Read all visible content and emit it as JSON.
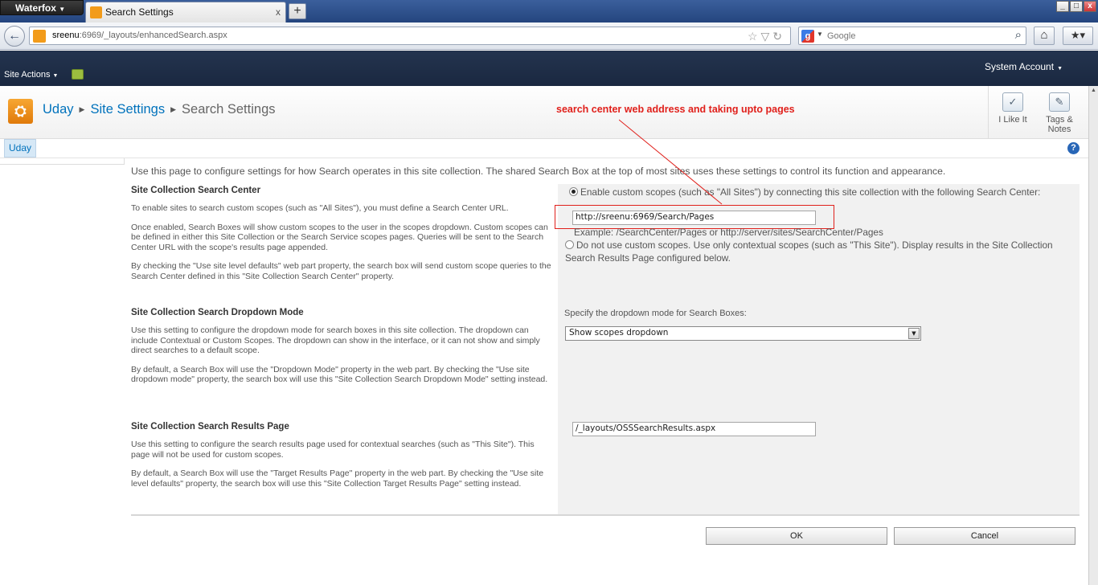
{
  "browser": {
    "app_button": "Waterfox",
    "tab_title": "Search Settings",
    "tab_close": "x",
    "new_tab": "+",
    "url_host": "sreenu",
    "url_rest": ":6969/_layouts/enhancedSearch.aspx",
    "search_placeholder": "Google",
    "window_controls": [
      "_",
      "□",
      "x"
    ]
  },
  "sharepoint": {
    "site_actions": "Site Actions",
    "system_account": "System Account",
    "breadcrumb": [
      "Uday",
      "Site Settings",
      "Search Settings"
    ],
    "annotation": "search center web address and taking upto pages",
    "i_like_it": "I Like It",
    "tags_notes_1": "Tags &",
    "tags_notes_2": "Notes",
    "top_nav_tab": "Uday",
    "help": "?"
  },
  "page": {
    "intro": "Use this page to configure settings for how Search operates in this site collection.  The shared Search Box at the top of most sites uses these settings to control its function and appearance.",
    "section1": {
      "title": "Site Collection Search Center",
      "desc": [
        "To enable sites to search custom scopes (such as \"All Sites\"), you must define a Search Center URL.",
        "Once enabled, Search Boxes will show custom scopes to the user in the scopes dropdown.  Custom scopes can be defined in either this Site Collection or the Search Service scopes pages.  Queries will be sent to the Search Center URL with the scope's results page appended.",
        "By checking the \"Use site level defaults\" web part property, the search box will send custom scope queries to the Search Center defined in this \"Site Collection Search Center\" property."
      ],
      "radio1": "Enable custom scopes (such as \"All Sites\") by connecting this site collection with the following Search Center:",
      "url_value": "http://sreenu:6969/Search/Pages",
      "example": "Example: /SearchCenter/Pages or http://server/sites/SearchCenter/Pages",
      "radio2": "Do not use custom scopes. Use only contextual scopes (such as \"This Site\"). Display results in the Site Collection Search Results Page configured below."
    },
    "section2": {
      "title": "Site Collection Search Dropdown Mode",
      "desc": [
        "Use this setting to configure the dropdown mode for search boxes in this site collection.  The dropdown can include Contextual or Custom Scopes.  The dropdown can show in the interface, or it can not show and simply direct searches to a default scope.",
        "By default, a Search Box will use the \"Dropdown Mode\" property in the web part.  By checking the \"Use site dropdown mode\" property, the search box will use this \"Site Collection Search Dropdown Mode\" setting instead."
      ],
      "label": "Specify the dropdown mode for Search Boxes:",
      "selected": "Show scopes dropdown"
    },
    "section3": {
      "title": "Site Collection Search Results Page",
      "desc": [
        "Use this setting to configure the search results page used for contextual searches (such as \"This Site\").  This page will not be used for custom scopes.",
        "By default, a Search Box will use the \"Target Results Page\" property in the web part. By checking the \"Use site level defaults\" property, the search box will use this \"Site Collection Target Results Page\" setting instead."
      ],
      "results_value": "/_layouts/OSSSearchResults.aspx"
    },
    "ok": "OK",
    "cancel": "Cancel"
  },
  "colors": {
    "annotation_red": "#e0201b",
    "link_blue": "#0072bc",
    "ribbon_dark": "#1f2d47"
  }
}
